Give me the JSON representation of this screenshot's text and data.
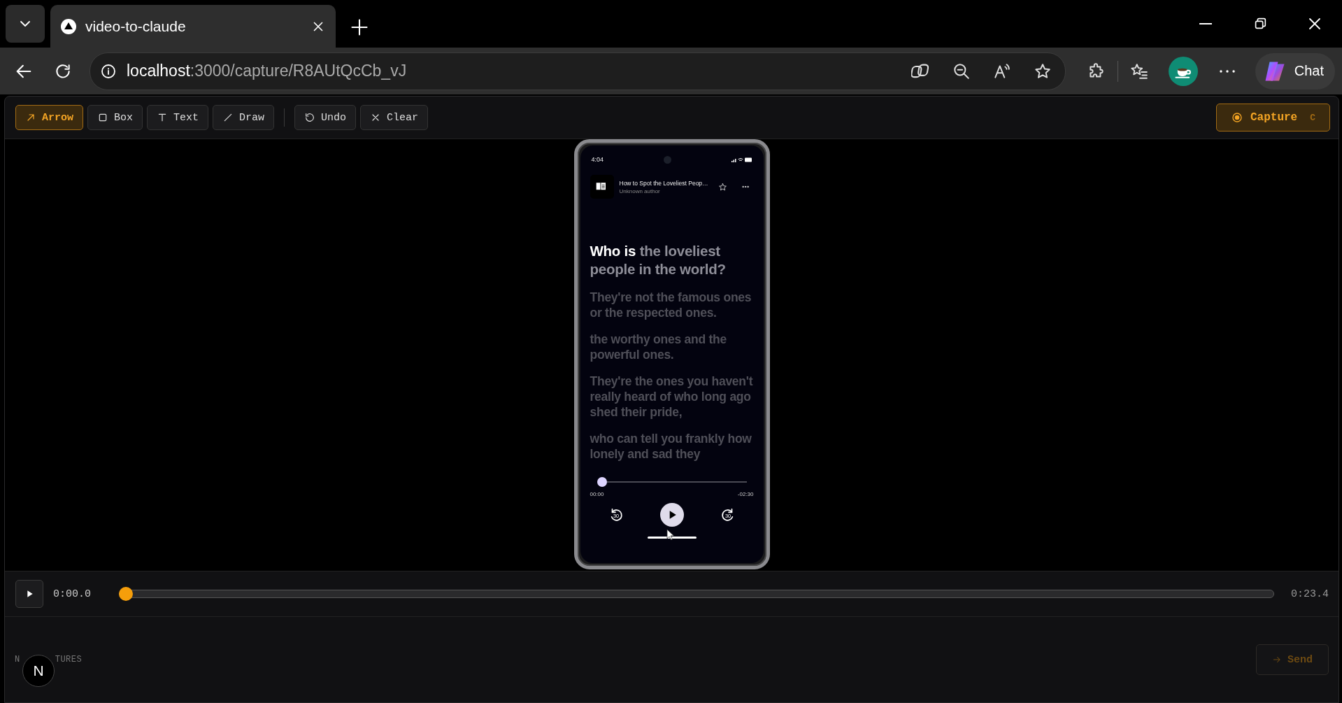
{
  "browser": {
    "tab": {
      "title": "video-to-claude"
    },
    "url": {
      "host": "localhost",
      "path": ":3000/capture/R8AUtQcCb_vJ"
    },
    "chat_button": "Chat"
  },
  "toolbar": {
    "tools": [
      {
        "label": "Arrow",
        "selected": true
      },
      {
        "label": "Box",
        "selected": false
      },
      {
        "label": "Text",
        "selected": false
      },
      {
        "label": "Draw",
        "selected": false
      }
    ],
    "actions": [
      "Undo",
      "Clear"
    ],
    "capture": {
      "label": "Capture",
      "shortcut": "C"
    }
  },
  "phone": {
    "status_time": "4:04",
    "book_title": "How to Spot the Loveliest Peop…",
    "author": "Unknown author",
    "lyrics": [
      {
        "sung": "Who is",
        "unsung": "the loveliest people in the world?",
        "active": true
      },
      {
        "unsung": "They're not the famous ones or the respected ones.",
        "active": false
      },
      {
        "unsung": "the worthy ones and the powerful ones.",
        "active": false
      },
      {
        "unsung": "They're the ones you haven't really heard of who long ago shed their pride,",
        "active": false
      },
      {
        "unsung": "who can tell you frankly how lonely and sad they",
        "active": false
      }
    ],
    "progress": {
      "level": 0
    },
    "elapsed": "00:00",
    "remaining": "-02:30",
    "skip_back_label": "30",
    "skip_forward_label": "30"
  },
  "timeline": {
    "current": "0:00.0",
    "duration": "0:23.4",
    "level": 0
  },
  "footer": {
    "captures_label_start": "N",
    "captures_label_end": "TURES",
    "badge": "N",
    "send": {
      "label": "Send",
      "disabled": true
    }
  }
}
